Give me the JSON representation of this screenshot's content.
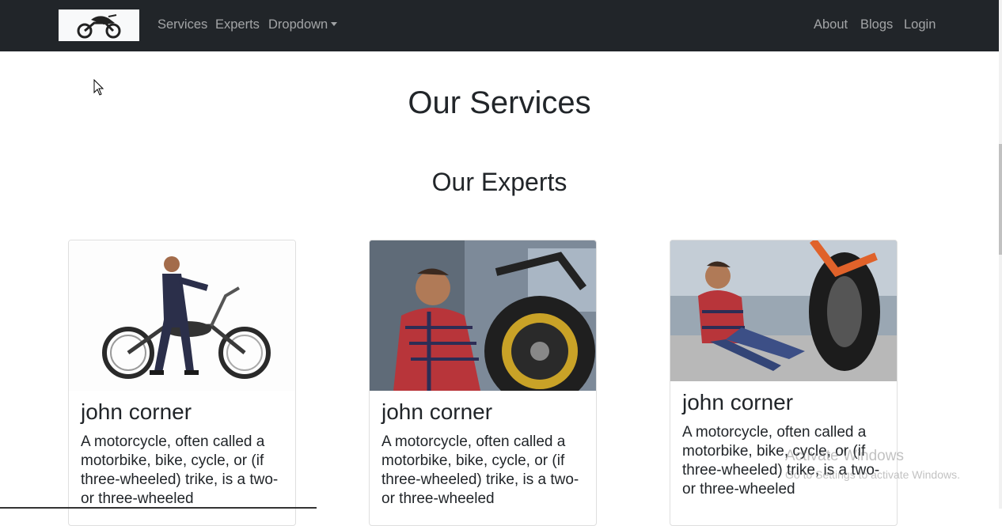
{
  "navbar": {
    "left_links": [
      "Services",
      "Experts",
      "Dropdown"
    ],
    "right_links": [
      "About",
      "Blogs",
      "Login"
    ]
  },
  "main": {
    "title": "Our Services",
    "experts_title": "Our Experts"
  },
  "experts": [
    {
      "name": "john corner",
      "description": "A motorcycle, often called a motorbike, bike, cycle, or (if three-wheeled) trike, is a two- or three-wheeled"
    },
    {
      "name": "john corner",
      "description": "A motorcycle, often called a motorbike, bike, cycle, or (if three-wheeled) trike, is a two- or three-wheeled"
    },
    {
      "name": "john corner",
      "description": "A motorcycle, often called a motorbike, bike, cycle, or (if three-wheeled) trike, is a two- or three-wheeled"
    }
  ],
  "os_watermark": {
    "line1": "Activate Windows",
    "line2": "Go to Settings to activate Windows."
  },
  "colors": {
    "navbar_bg": "#212529",
    "nav_link": "rgba(255,255,255,0.55)",
    "page_bg": "#ffffff"
  }
}
